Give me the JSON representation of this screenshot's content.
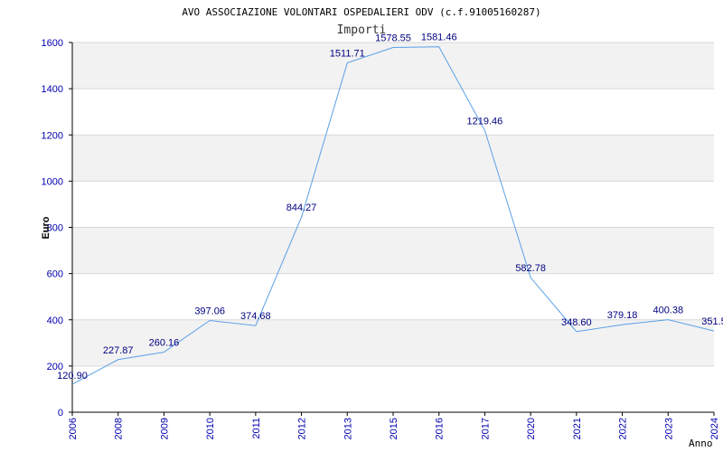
{
  "chart_data": {
    "type": "line",
    "title": "AVO ASSOCIAZIONE VOLONTARI OSPEDALIERI ODV (c.f.91005160287)",
    "subtitle": "Importi",
    "xlabel": "Anno",
    "ylabel": "Euro",
    "ylim": [
      0,
      1600
    ],
    "yticks": [
      "0",
      "200",
      "400",
      "600",
      "800",
      "1000",
      "1200",
      "1400",
      "1600"
    ],
    "categories": [
      "2006",
      "2008",
      "2009",
      "2010",
      "2011",
      "2012",
      "2013",
      "2015",
      "2016",
      "2017",
      "2020",
      "2021",
      "2022",
      "2023",
      "2024"
    ],
    "series": [
      {
        "values": [
          120.9,
          227.87,
          260.16,
          397.06,
          374.68,
          844.27,
          1511.71,
          1578.55,
          1581.46,
          1219.46,
          582.78,
          348.6,
          379.18,
          400.38,
          351.5
        ],
        "labels": [
          "120.90",
          "227.87",
          "260.16",
          "397.06",
          "374.68",
          "844.27",
          "1511.71",
          "1578.55",
          "1581.46",
          "1219.46",
          "582.78",
          "348.60",
          "379.18",
          "400.38",
          "351.5"
        ]
      }
    ],
    "grid": "horizontal-bands",
    "colors": {
      "line": "#5aa0e6",
      "band": "#f2f2f2",
      "grid": "#d8d8d8",
      "tick": "#0000b0",
      "data_label": "#000080"
    }
  }
}
